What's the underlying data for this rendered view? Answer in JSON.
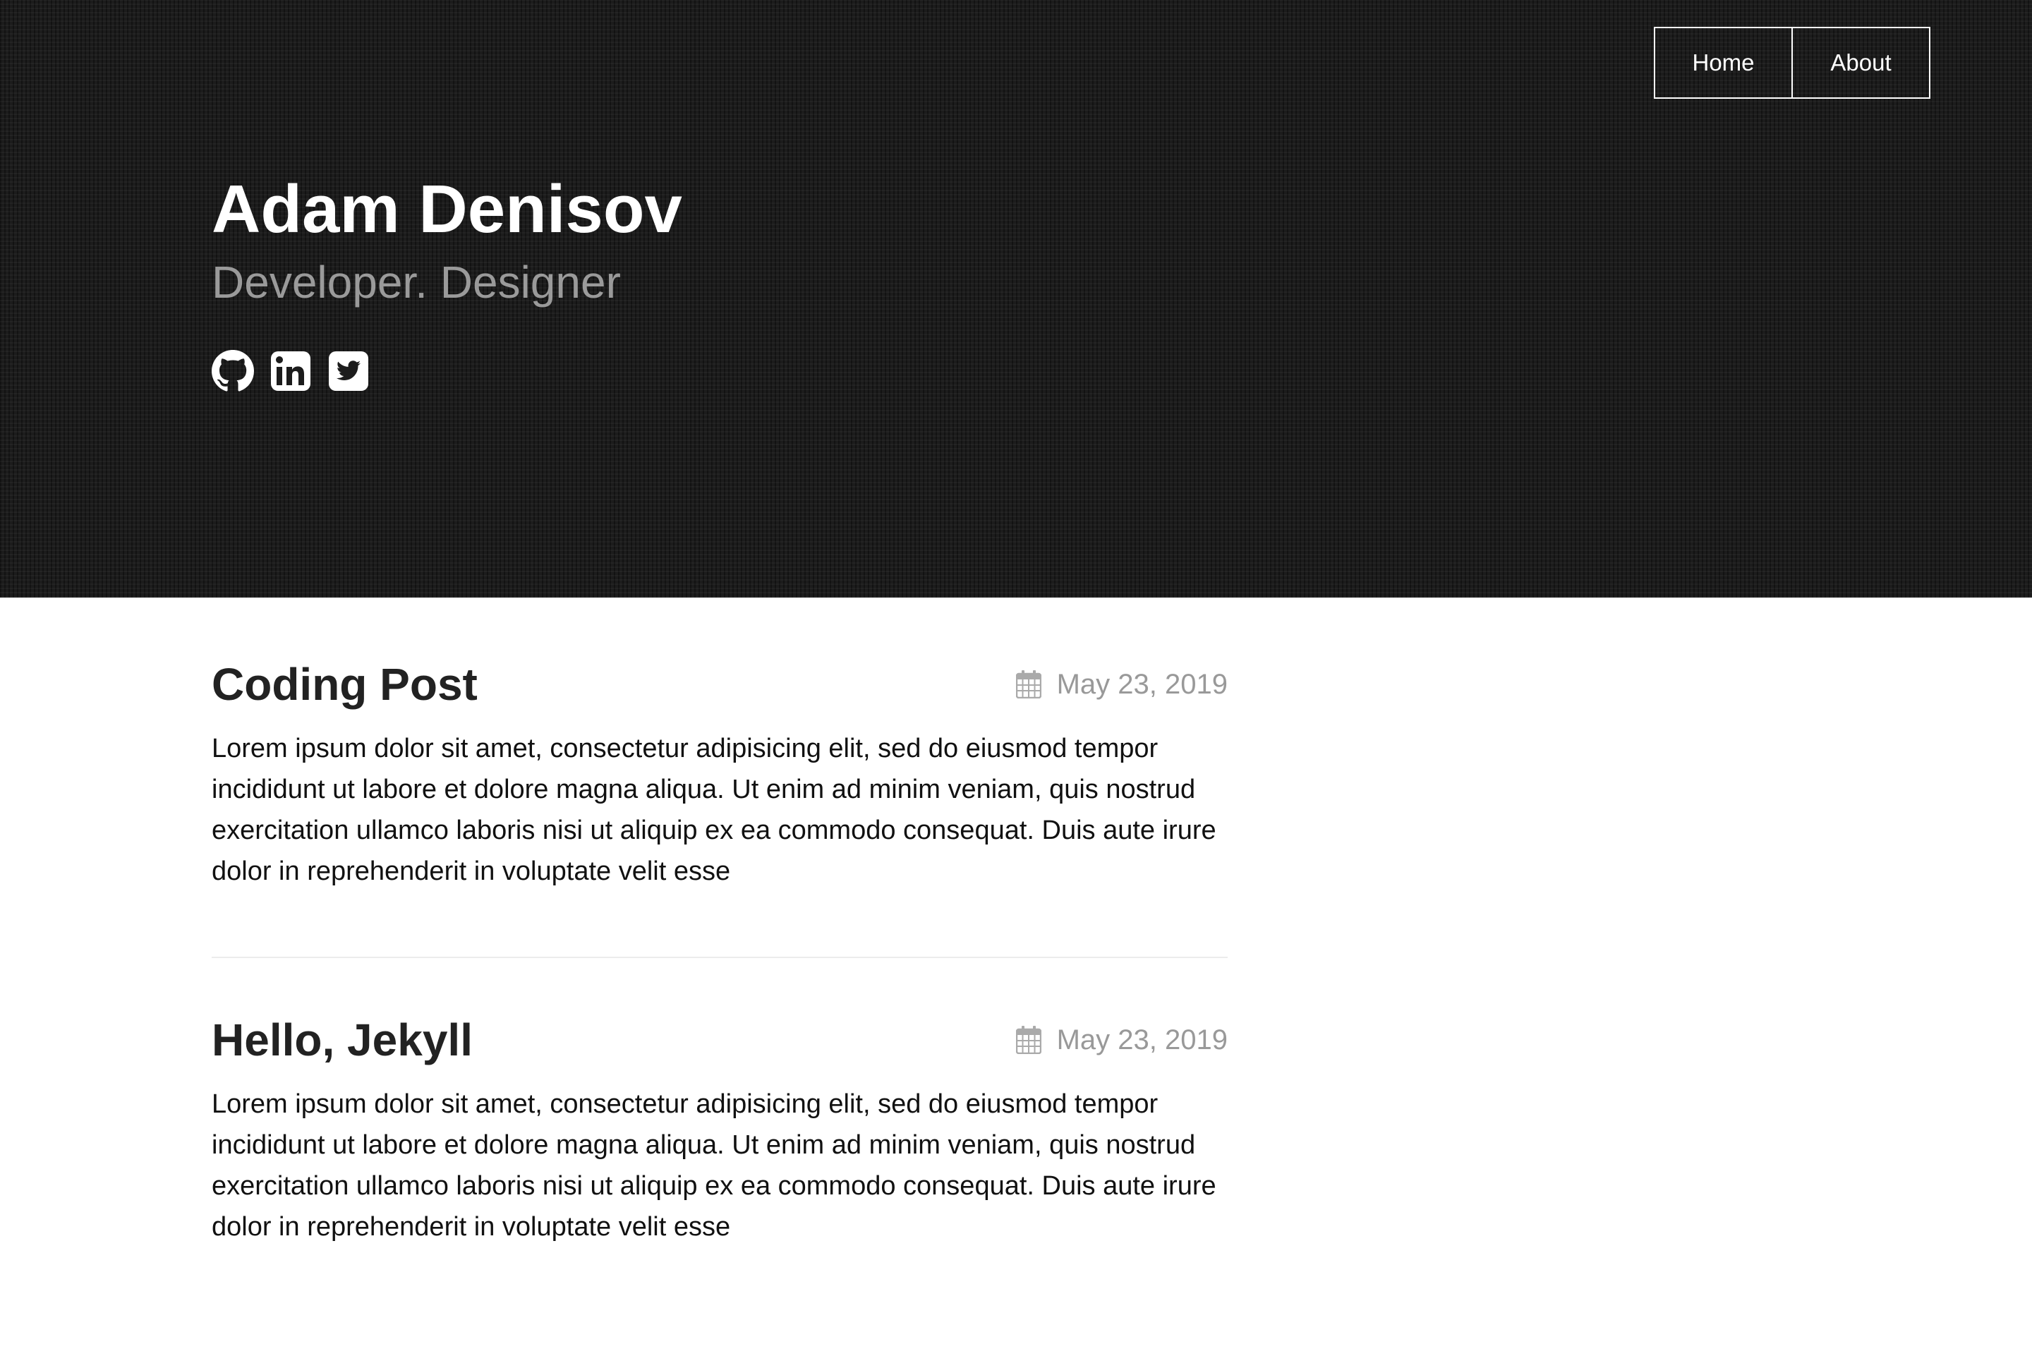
{
  "nav": {
    "items": [
      {
        "label": "Home"
      },
      {
        "label": "About"
      }
    ]
  },
  "header": {
    "name": "Adam Denisov",
    "tagline": "Developer. Designer",
    "social_icons": [
      "github-icon",
      "linkedin-icon",
      "twitter-icon"
    ]
  },
  "posts": [
    {
      "title": "Coding Post",
      "date": "May 23, 2019",
      "excerpt": "Lorem ipsum dolor sit amet, consectetur adipisicing elit, sed do eiusmod tempor incididunt ut labore et dolore magna aliqua. Ut enim ad minim veniam, quis nostrud exercitation ullamco laboris nisi ut aliquip ex ea commodo consequat. Duis aute irure dolor in reprehenderit in voluptate velit esse"
    },
    {
      "title": "Hello, Jekyll",
      "date": "May 23, 2019",
      "excerpt": "Lorem ipsum dolor sit amet, consectetur adipisicing elit, sed do eiusmod tempor incididunt ut labore et dolore magna aliqua. Ut enim ad minim veniam, quis nostrud exercitation ullamco laboris nisi ut aliquip ex ea commodo consequat. Duis aute irure dolor in reprehenderit in voluptate velit esse"
    }
  ],
  "colors": {
    "hero_background": "#1c1c1c",
    "hero_text": "#ffffff",
    "tagline": "#9a9a9a",
    "post_title": "#222222",
    "date_text": "#999999",
    "body_text": "#111111"
  }
}
